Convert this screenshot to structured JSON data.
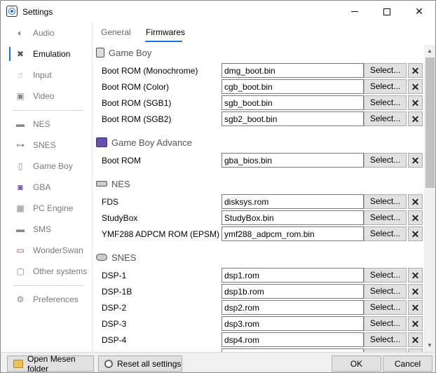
{
  "window": {
    "title": "Settings"
  },
  "sidebar": {
    "items": [
      {
        "label": "Audio",
        "icon": "speaker-icon",
        "selected": false
      },
      {
        "label": "Emulation",
        "icon": "tools-icon",
        "selected": true
      },
      {
        "label": "Input",
        "icon": "input-icon",
        "selected": false
      },
      {
        "label": "Video",
        "icon": "monitor-icon",
        "selected": false
      },
      {
        "label": "NES",
        "icon": "nes-console-icon",
        "selected": false
      },
      {
        "label": "SNES",
        "icon": "snes-controller-icon",
        "selected": false
      },
      {
        "label": "Game Boy",
        "icon": "gameboy-icon",
        "selected": false
      },
      {
        "label": "GBA",
        "icon": "gba-icon",
        "selected": false
      },
      {
        "label": "PC Engine",
        "icon": "pc-engine-icon",
        "selected": false
      },
      {
        "label": "SMS",
        "icon": "sms-console-icon",
        "selected": false
      },
      {
        "label": "WonderSwan",
        "icon": "wonderswan-icon",
        "selected": false
      },
      {
        "label": "Other systems",
        "icon": "other-systems-icon",
        "selected": false
      },
      {
        "label": "Preferences",
        "icon": "gear-icon",
        "selected": false
      }
    ]
  },
  "tabs": [
    {
      "label": "General",
      "active": false
    },
    {
      "label": "Firmwares",
      "active": true
    }
  ],
  "sections": {
    "gameboy": {
      "title": "Game Boy",
      "rows": [
        {
          "label": "Boot ROM (Monochrome)",
          "value": "dmg_boot.bin"
        },
        {
          "label": "Boot ROM (Color)",
          "value": "cgb_boot.bin"
        },
        {
          "label": "Boot ROM (SGB1)",
          "value": "sgb_boot.bin"
        },
        {
          "label": "Boot ROM (SGB2)",
          "value": "sgb2_boot.bin"
        }
      ]
    },
    "gba": {
      "title": "Game Boy Advance",
      "rows": [
        {
          "label": "Boot ROM",
          "value": "gba_bios.bin"
        }
      ]
    },
    "nes": {
      "title": "NES",
      "rows": [
        {
          "label": "FDS",
          "value": "disksys.rom"
        },
        {
          "label": "StudyBox",
          "value": "StudyBox.bin"
        },
        {
          "label": "YMF288 ADPCM ROM (EPSM)",
          "value": "ymf288_adpcm_rom.bin"
        }
      ]
    },
    "snes": {
      "title": "SNES",
      "rows": [
        {
          "label": "DSP-1",
          "value": "dsp1.rom"
        },
        {
          "label": "DSP-1B",
          "value": "dsp1b.rom"
        },
        {
          "label": "DSP-2",
          "value": "dsp2.rom"
        },
        {
          "label": "DSP-3",
          "value": "dsp3.rom"
        },
        {
          "label": "DSP-4",
          "value": "dsp4.rom"
        }
      ]
    }
  },
  "select_label": "Select...",
  "bottom": {
    "open_folder": "Open Mesen folder",
    "reset_all": "Reset all settings",
    "ok": "OK",
    "cancel": "Cancel"
  },
  "colors": {
    "accent": "#1e6fd9"
  }
}
